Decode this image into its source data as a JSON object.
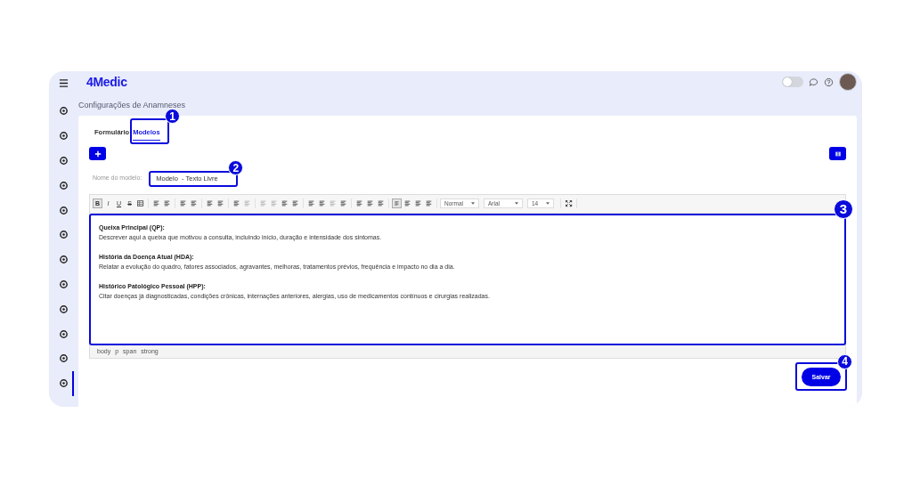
{
  "header": {
    "logo": "4Medic",
    "theme_toggle": {
      "on": false
    }
  },
  "sidebar": {
    "items": [
      {
        "selected": false
      },
      {
        "selected": false
      },
      {
        "selected": false
      },
      {
        "selected": false
      },
      {
        "selected": false
      },
      {
        "selected": false
      },
      {
        "selected": false
      },
      {
        "selected": false
      },
      {
        "selected": false
      },
      {
        "selected": false
      },
      {
        "selected": false
      },
      {
        "selected": true
      }
    ]
  },
  "page_title": "Configurações de Anamneses",
  "tabs": [
    {
      "label": "Formulário",
      "selected": false
    },
    {
      "label": "Modelos",
      "selected": true
    }
  ],
  "model_name": {
    "label": "Nome do modelo:",
    "value": "Modelo  - Texto Livre"
  },
  "toolbar": {
    "format_buttons": [
      {
        "label": "B",
        "selected": true
      },
      {
        "label": "I",
        "selected": false
      },
      {
        "label": "U",
        "selected": false
      },
      {
        "label": "S",
        "selected": false
      }
    ],
    "dropdowns": [
      "Normal",
      "Arial",
      "14"
    ]
  },
  "editor": {
    "sections": [
      {
        "heading": "Queixa Principal (QP):",
        "text": "Descrever aqui a queixa que motivou a consulta, incluindo início, duração e intensidade dos sintomas."
      },
      {
        "heading": "História da Doença Atual (HDA):",
        "text": "Relatar a evolução do quadro, fatores associados, agravantes, melhoras, tratamentos prévios, frequência e impacto no dia a dia."
      },
      {
        "heading": "Histórico Patológico Pessoal (HPP):",
        "text": "Citar doenças já diagnosticadas, condições crônicas, internações anteriores, alergias, uso de medicamentos contínuos e cirurgias realizadas."
      }
    ],
    "path": [
      "body",
      "p",
      "span",
      "strong"
    ]
  },
  "save_button": "Salvar",
  "callouts": [
    "1",
    "2",
    "3",
    "4"
  ]
}
